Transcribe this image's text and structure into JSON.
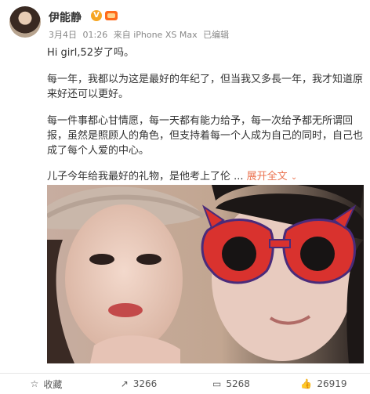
{
  "post": {
    "username": "伊能静",
    "verified_badge": "V",
    "meta": {
      "date": "3月4日",
      "time": "01:26",
      "source": "来自 iPhone XS Max",
      "edited": "已编辑"
    },
    "paragraphs": [
      "Hi girl,52岁了吗。",
      "每一年，我都以为这是最好的年纪了，但当我又多長一年，我才知道原来好还可以更好。",
      "每一件事都心甘情愿，每一天都有能力给予，每一次给予都无所谓回报，虽然是照顾人的角色，但支持着每一个人成为自己的同时，自己也成了每个人爱的中心。",
      "儿子今年给我最好的礼物，是他考上了伦 ..."
    ],
    "expand_label": "展开全文",
    "image_alt": "photo"
  },
  "actions": {
    "favorite": "收藏",
    "repost_count": "3266",
    "comment_count": "5268",
    "like_count": "26919"
  },
  "colors": {
    "accent": "#eb7350",
    "verified": "#f6a623",
    "member": "#ff6b1a"
  }
}
